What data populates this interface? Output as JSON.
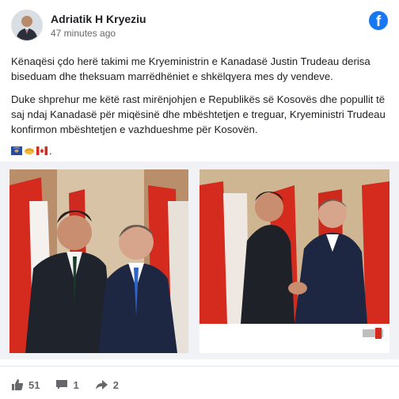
{
  "post": {
    "author": "Adriatik H Kryeziu",
    "time": "47 minutes ago",
    "paragraphs": [
      "Kënaqësi çdo herë takimi me Kryeministrin e Kanadasë Justin Trudeau derisa biseduam dhe theksuam marrëdhëniet e shkëlqyera mes dy vendeve.",
      "Duke shprehur me këtë rast mirënjohjen e Republikës së Kosovës dhe popullit të saj ndaj Kanadasë për miqësinë dhe mbështetjen e treguar, Kryeministri Trudeau konfirmon mbështetjen e vazhdueshme për Kosovën."
    ],
    "emoji_trail": ".",
    "emoji_icons": [
      "kosovo-flag-icon",
      "handshake-icon",
      "canada-flag-icon"
    ]
  },
  "icons": {
    "brand": "facebook-icon"
  },
  "colors": {
    "facebook_blue": "#1877f2",
    "canada_red": "#d52b1e",
    "kosovo_blue": "#244aa5"
  },
  "footer": {
    "likes": "51",
    "comments": "1",
    "shares": "2"
  }
}
